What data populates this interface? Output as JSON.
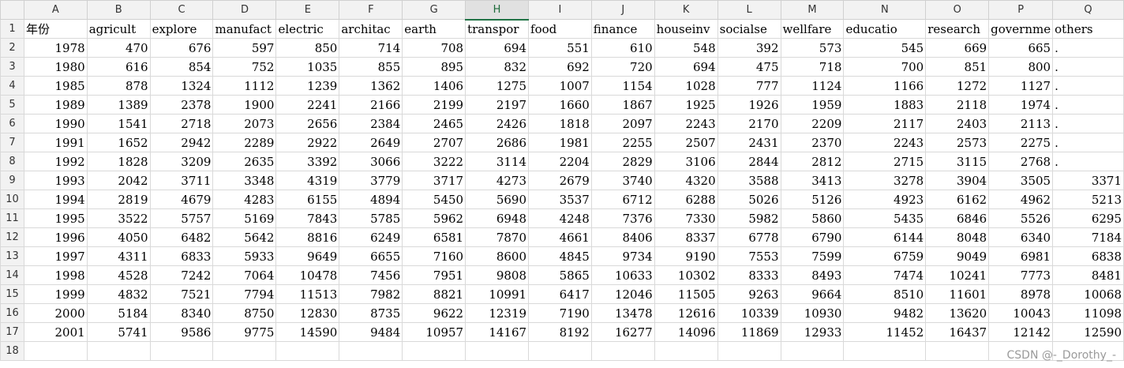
{
  "sheet": {
    "columns": [
      "A",
      "B",
      "C",
      "D",
      "E",
      "F",
      "G",
      "H",
      "I",
      "J",
      "K",
      "L",
      "M",
      "N",
      "O",
      "P",
      "Q"
    ],
    "selected_column": "H",
    "row_numbers": [
      "1",
      "2",
      "3",
      "4",
      "5",
      "6",
      "7",
      "8",
      "9",
      "10",
      "11",
      "12",
      "13",
      "14",
      "15",
      "16",
      "17",
      "18"
    ],
    "header_row": [
      "年份",
      "agricult",
      "explore",
      "manufact",
      "electric",
      "architac",
      "earth",
      "transpor",
      "food",
      "finance",
      "houseinv",
      "socialse",
      "wellfare",
      "educatio",
      "research",
      "governme",
      "others"
    ],
    "rows": [
      [
        "1978",
        "470",
        "676",
        "597",
        "850",
        "714",
        "708",
        "694",
        "551",
        "610",
        "548",
        "392",
        "573",
        "545",
        "669",
        "665",
        "."
      ],
      [
        "1980",
        "616",
        "854",
        "752",
        "1035",
        "855",
        "895",
        "832",
        "692",
        "720",
        "694",
        "475",
        "718",
        "700",
        "851",
        "800",
        "."
      ],
      [
        "1985",
        "878",
        "1324",
        "1112",
        "1239",
        "1362",
        "1406",
        "1275",
        "1007",
        "1154",
        "1028",
        "777",
        "1124",
        "1166",
        "1272",
        "1127",
        "."
      ],
      [
        "1989",
        "1389",
        "2378",
        "1900",
        "2241",
        "2166",
        "2199",
        "2197",
        "1660",
        "1867",
        "1925",
        "1926",
        "1959",
        "1883",
        "2118",
        "1974",
        "."
      ],
      [
        "1990",
        "1541",
        "2718",
        "2073",
        "2656",
        "2384",
        "2465",
        "2426",
        "1818",
        "2097",
        "2243",
        "2170",
        "2209",
        "2117",
        "2403",
        "2113",
        "."
      ],
      [
        "1991",
        "1652",
        "2942",
        "2289",
        "2922",
        "2649",
        "2707",
        "2686",
        "1981",
        "2255",
        "2507",
        "2431",
        "2370",
        "2243",
        "2573",
        "2275",
        "."
      ],
      [
        "1992",
        "1828",
        "3209",
        "2635",
        "3392",
        "3066",
        "3222",
        "3114",
        "2204",
        "2829",
        "3106",
        "2844",
        "2812",
        "2715",
        "3115",
        "2768",
        "."
      ],
      [
        "1993",
        "2042",
        "3711",
        "3348",
        "4319",
        "3779",
        "3717",
        "4273",
        "2679",
        "3740",
        "4320",
        "3588",
        "3413",
        "3278",
        "3904",
        "3505",
        "3371"
      ],
      [
        "1994",
        "2819",
        "4679",
        "4283",
        "6155",
        "4894",
        "5450",
        "5690",
        "3537",
        "6712",
        "6288",
        "5026",
        "5126",
        "4923",
        "6162",
        "4962",
        "5213"
      ],
      [
        "1995",
        "3522",
        "5757",
        "5169",
        "7843",
        "5785",
        "5962",
        "6948",
        "4248",
        "7376",
        "7330",
        "5982",
        "5860",
        "5435",
        "6846",
        "5526",
        "6295"
      ],
      [
        "1996",
        "4050",
        "6482",
        "5642",
        "8816",
        "6249",
        "6581",
        "7870",
        "4661",
        "8406",
        "8337",
        "6778",
        "6790",
        "6144",
        "8048",
        "6340",
        "7184"
      ],
      [
        "1997",
        "4311",
        "6833",
        "5933",
        "9649",
        "6655",
        "7160",
        "8600",
        "4845",
        "9734",
        "9190",
        "7553",
        "7599",
        "6759",
        "9049",
        "6981",
        "6838"
      ],
      [
        "1998",
        "4528",
        "7242",
        "7064",
        "10478",
        "7456",
        "7951",
        "9808",
        "5865",
        "10633",
        "10302",
        "8333",
        "8493",
        "7474",
        "10241",
        "7773",
        "8481"
      ],
      [
        "1999",
        "4832",
        "7521",
        "7794",
        "11513",
        "7982",
        "8821",
        "10991",
        "6417",
        "12046",
        "11505",
        "9263",
        "9664",
        "8510",
        "11601",
        "8978",
        "10068"
      ],
      [
        "2000",
        "5184",
        "8340",
        "8750",
        "12830",
        "8735",
        "9622",
        "12319",
        "7190",
        "13478",
        "12616",
        "10339",
        "10930",
        "9482",
        "13620",
        "10043",
        "11098"
      ],
      [
        "2001",
        "5741",
        "9586",
        "9775",
        "14590",
        "9484",
        "10957",
        "14167",
        "8192",
        "16277",
        "14096",
        "11869",
        "12933",
        "11452",
        "16437",
        "12142",
        "12590"
      ]
    ]
  },
  "watermark": "CSDN @-_Dorothy_-"
}
